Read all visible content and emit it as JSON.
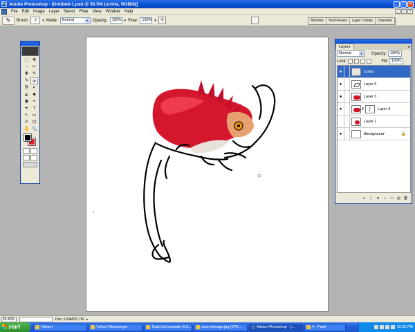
{
  "window": {
    "title": "Adobe Photoshop - [Untitled-1.psd @ 56.5% (schita, RGB/8)]",
    "app_icon_glyph": "Ps",
    "minimize": "_",
    "maximize": "□",
    "close": "×"
  },
  "menu": {
    "items": [
      "File",
      "Edit",
      "Image",
      "Layer",
      "Select",
      "Filter",
      "View",
      "Window",
      "Help"
    ],
    "mdi_minimize": "_",
    "mdi_restore": "▫",
    "mdi_close": "×"
  },
  "options_bar": {
    "tool_glyph": "✎",
    "brush_label": "Brush:",
    "brush_size": "3",
    "mode_label": "Mode:",
    "mode_value": "Normal",
    "opacity_label": "Opacity:",
    "opacity_value": "100%",
    "flow_label": "Flow:",
    "flow_value": "100%",
    "dropdown_glyph": "▾",
    "airbrush_glyph": "✢",
    "palette_well_tabs": [
      "Brushes",
      "Tool Presets",
      "Layer Comps",
      "Channels"
    ]
  },
  "toolbox": {
    "tools": [
      "⬚",
      "✥",
      "◌",
      "✂",
      "✚",
      "✎",
      "✎",
      "⊕",
      "⎘",
      "◐",
      "◭",
      "⬥",
      "◉",
      "⌖",
      "✒",
      "T",
      "↖",
      "▭",
      "✐",
      "⊡",
      "✋",
      "🔍"
    ],
    "foreground_color": "#000000",
    "background_color": "#e11b2b"
  },
  "layers_panel": {
    "tab_label": "Layers",
    "menu_glyph": "▸",
    "blend_mode": "Normal",
    "opacity_label": "Opacity:",
    "opacity_value": "100%",
    "lock_label": "Lock:",
    "fill_label": "Fill:",
    "fill_value": "100%",
    "layers": [
      {
        "name": "schita",
        "visible": true,
        "selected": true
      },
      {
        "name": "Layer 5",
        "visible": true,
        "selected": false
      },
      {
        "name": "Layer 3",
        "visible": true,
        "selected": false
      },
      {
        "name": "Layer 4",
        "visible": true,
        "selected": false
      },
      {
        "name": "Layer 1",
        "visible": false,
        "selected": false
      },
      {
        "name": "Background",
        "visible": true,
        "selected": false,
        "locked": true
      }
    ],
    "eye_glyph": "●",
    "lock_glyph": "🔒",
    "mask_glyph": "ʃ",
    "chain_glyph": "8",
    "footer_buttons": [
      "∞",
      "ƒ",
      "◘",
      "◑",
      "▭",
      "▤",
      "🗑"
    ]
  },
  "status_bar": {
    "zoom": "56.45%",
    "doc_info": "Doc: 5.60M/22.7M",
    "arrow": "▸"
  },
  "taskbar": {
    "start_label": "start",
    "tasks": [
      {
        "label": "Yahoo!",
        "active": false
      },
      {
        "label": "Yahoo! Messenger",
        "active": false
      },
      {
        "label": "Total Commander 6.0...",
        "active": false
      },
      {
        "label": "sourceimage.jpg (JPE...",
        "active": false
      },
      {
        "label": "Adobe Photoshop - [...",
        "active": true
      },
      {
        "label": "4 - Paint",
        "active": false
      }
    ],
    "clock": "10:32 PM"
  }
}
